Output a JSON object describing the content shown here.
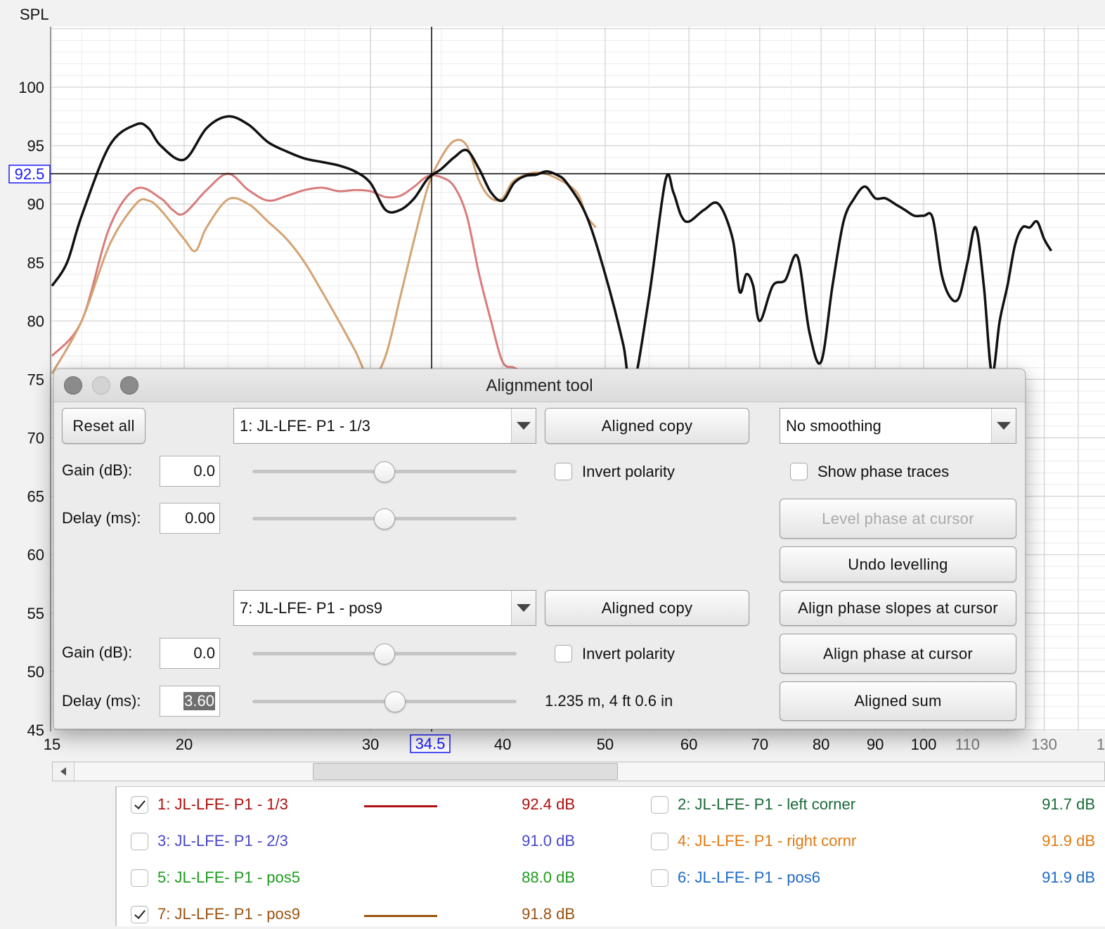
{
  "graph": {
    "y_axis_title": "SPL",
    "cursor_y_label": "92.5",
    "cursor_x_label": "34.5",
    "y_ticks": [
      "100",
      "95",
      "90",
      "85",
      "80",
      "75",
      "70",
      "65",
      "60",
      "55",
      "50",
      "45"
    ],
    "x_ticks": [
      "15",
      "20",
      "30",
      "40",
      "50",
      "60",
      "70",
      "80",
      "90",
      "100",
      "110",
      "130",
      "1"
    ]
  },
  "chart_data": {
    "type": "line",
    "xlabel": "",
    "ylabel": "SPL",
    "x_scale": "log",
    "xlim": [
      15,
      160
    ],
    "ylim": [
      45,
      105
    ],
    "cursor": {
      "x": 34.5,
      "y": 92.5
    },
    "series": [
      {
        "name": "1: JL-LFE- P1 - 1/3",
        "color": "#d97b7b",
        "points": [
          [
            15,
            77
          ],
          [
            16,
            80
          ],
          [
            17,
            88
          ],
          [
            18,
            91.3
          ],
          [
            19,
            90.5
          ],
          [
            19.5,
            89.5
          ],
          [
            20,
            89.2
          ],
          [
            21,
            91.2
          ],
          [
            22,
            92.6
          ],
          [
            23,
            91.2
          ],
          [
            24,
            90.3
          ],
          [
            25,
            90.7
          ],
          [
            26,
            91.2
          ],
          [
            27,
            91.4
          ],
          [
            28,
            91.1
          ],
          [
            29,
            91.2
          ],
          [
            30,
            91.1
          ],
          [
            31,
            90.6
          ],
          [
            32,
            90.7
          ],
          [
            33,
            91.5
          ],
          [
            34,
            92.4
          ],
          [
            35,
            92.3
          ],
          [
            36,
            91.5
          ],
          [
            37,
            89
          ],
          [
            38,
            84
          ],
          [
            39,
            80
          ],
          [
            40,
            76.5
          ],
          [
            41,
            76
          ],
          [
            42,
            75.5
          ]
        ]
      },
      {
        "name": "7: JL-LFE- P1 - pos9",
        "color": "#d4a373",
        "points": [
          [
            15,
            75.5
          ],
          [
            16,
            80
          ],
          [
            17,
            86.5
          ],
          [
            18,
            90
          ],
          [
            18.5,
            90.3
          ],
          [
            19,
            89.5
          ],
          [
            20,
            87
          ],
          [
            20.5,
            86
          ],
          [
            21,
            88
          ],
          [
            22,
            90.4
          ],
          [
            23,
            90
          ],
          [
            24,
            88.5
          ],
          [
            25,
            87
          ],
          [
            26,
            85
          ],
          [
            27,
            82.5
          ],
          [
            28,
            80
          ],
          [
            29,
            77.5
          ],
          [
            30,
            75
          ],
          [
            31,
            77
          ],
          [
            32,
            82
          ],
          [
            33,
            87
          ],
          [
            34,
            91.5
          ],
          [
            35,
            94
          ],
          [
            36,
            95.4
          ],
          [
            37,
            95
          ],
          [
            38,
            92
          ],
          [
            39,
            90.5
          ],
          [
            40,
            90.5
          ],
          [
            41,
            92
          ],
          [
            43,
            92.7
          ],
          [
            45,
            92.2
          ],
          [
            47,
            91
          ],
          [
            48,
            89
          ],
          [
            49,
            88
          ]
        ]
      },
      {
        "name": "Aligned sum",
        "color": "#111111",
        "points": [
          [
            15,
            83
          ],
          [
            15.5,
            85
          ],
          [
            16,
            89
          ],
          [
            17,
            95
          ],
          [
            18,
            96.8
          ],
          [
            18.5,
            96.5
          ],
          [
            19,
            95
          ],
          [
            20,
            93.8
          ],
          [
            21,
            96.5
          ],
          [
            22,
            97.5
          ],
          [
            23,
            96.8
          ],
          [
            24,
            95.3
          ],
          [
            25,
            94.5
          ],
          [
            26,
            93.9
          ],
          [
            27,
            93.6
          ],
          [
            28,
            93.3
          ],
          [
            29,
            92.8
          ],
          [
            30,
            91.8
          ],
          [
            31,
            89.5
          ],
          [
            32,
            89.5
          ],
          [
            33,
            90.5
          ],
          [
            34,
            92.2
          ],
          [
            35,
            93
          ],
          [
            36,
            94
          ],
          [
            37,
            94.6
          ],
          [
            38,
            93
          ],
          [
            39,
            91
          ],
          [
            40,
            90.3
          ],
          [
            41,
            91.8
          ],
          [
            42,
            92.4
          ],
          [
            43,
            92.5
          ],
          [
            44,
            92.8
          ],
          [
            45,
            92.5
          ],
          [
            46,
            91.8
          ],
          [
            48,
            89
          ],
          [
            50,
            84
          ],
          [
            52,
            78
          ],
          [
            53,
            74
          ],
          [
            55,
            82
          ],
          [
            57,
            92
          ],
          [
            58,
            91
          ],
          [
            59,
            89
          ],
          [
            60,
            88.5
          ],
          [
            62,
            89.5
          ],
          [
            64,
            90
          ],
          [
            66,
            87
          ],
          [
            67,
            82.5
          ],
          [
            68,
            84
          ],
          [
            69,
            83
          ],
          [
            70,
            80
          ],
          [
            72,
            83
          ],
          [
            74,
            83.5
          ],
          [
            76,
            85.5
          ],
          [
            78,
            79
          ],
          [
            80,
            76.5
          ],
          [
            82,
            83
          ],
          [
            84,
            88.5
          ],
          [
            86,
            90.5
          ],
          [
            88,
            91.5
          ],
          [
            90,
            90.5
          ],
          [
            92,
            90.5
          ],
          [
            94,
            90
          ],
          [
            96,
            89.5
          ],
          [
            98,
            89
          ],
          [
            100,
            89
          ],
          [
            102,
            88.8
          ],
          [
            104,
            84
          ],
          [
            106,
            82
          ],
          [
            108,
            82
          ],
          [
            110,
            85
          ],
          [
            112,
            88
          ],
          [
            114,
            83
          ],
          [
            116,
            75.5
          ],
          [
            118,
            80
          ],
          [
            120,
            83
          ],
          [
            122,
            86.5
          ],
          [
            124,
            88
          ],
          [
            126,
            88
          ],
          [
            128,
            88.5
          ],
          [
            130,
            87
          ],
          [
            132,
            86
          ]
        ]
      }
    ]
  },
  "scrollbar": {
    "label": "horizontal-scrollbar"
  },
  "legend": [
    {
      "name": "1: JL-LFE- P1 - 1/3",
      "value": "92.4 dB",
      "checked": true,
      "color": "#b00d0d",
      "swatch": "#b01010"
    },
    {
      "name": "2: JL-LFE- P1 - left corner",
      "value": "91.7 dB",
      "checked": false,
      "color": "#1a6a37"
    },
    {
      "name": "3: JL-LFE- P1 - 2/3",
      "value": "91.0 dB",
      "checked": false,
      "color": "#4747c8"
    },
    {
      "name": "4: JL-LFE- P1 - right cornr",
      "value": "91.9 dB",
      "checked": false,
      "color": "#e07a12"
    },
    {
      "name": "5: JL-LFE- P1 - pos5",
      "value": "88.0 dB",
      "checked": false,
      "color": "#1e9b1e"
    },
    {
      "name": "6: JL-LFE- P1 - pos6",
      "value": "91.9 dB",
      "checked": false,
      "color": "#1e6ac9"
    },
    {
      "name": "7: JL-LFE- P1 - pos9",
      "value": "91.8 dB",
      "checked": true,
      "color": "#9a5210",
      "swatch": "#9a5210"
    }
  ],
  "dialog": {
    "title": "Alignment tool",
    "reset_all": "Reset all",
    "top": {
      "measurement": "1: JL-LFE- P1 - 1/3",
      "aligned_copy": "Aligned copy",
      "gain_label": "Gain (dB):",
      "gain_value": "0.0",
      "gain_slider_position": 0.5,
      "delay_label": "Delay (ms):",
      "delay_value": "0.00",
      "delay_slider_position": 0.5,
      "invert_polarity": "Invert polarity",
      "invert_checked": false
    },
    "bottom": {
      "measurement": "7: JL-LFE- P1 - pos9",
      "aligned_copy": "Aligned copy",
      "gain_label": "Gain (dB):",
      "gain_value": "0.0",
      "gain_slider_position": 0.5,
      "delay_label": "Delay (ms):",
      "delay_value": "3.60",
      "delay_slider_position": 0.54,
      "distance": "1.235 m, 4 ft 0.6 in",
      "invert_polarity": "Invert polarity",
      "invert_checked": false
    },
    "right": {
      "smoothing": "No  smoothing",
      "show_phase_traces": "Show phase traces",
      "show_phase_checked": false,
      "level_phase": "Level phase at cursor",
      "undo_levelling": "Undo levelling",
      "align_phase_slopes": "Align phase slopes at cursor",
      "align_phase": "Align phase at cursor",
      "aligned_sum": "Aligned sum"
    }
  }
}
